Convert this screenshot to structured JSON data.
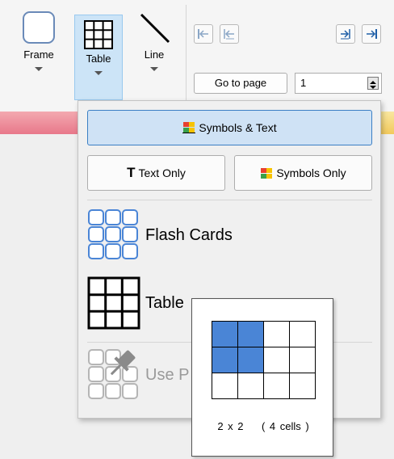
{
  "ribbon": {
    "frame_label": "Frame",
    "table_label": "Table",
    "line_label": "Line",
    "goto_label": "Go to page",
    "page_value": "1"
  },
  "dropdown": {
    "symbols_text": "Symbols & Text",
    "text_only": "Text Only",
    "symbols_only": "Symbols Only",
    "flash_cards": "Flash Cards",
    "table": "Table",
    "use_pin": "Use P"
  },
  "picker": {
    "rows": 3,
    "cols": 4,
    "selected_rows": 2,
    "selected_cols": 2,
    "size_text": "2 x 2",
    "cells_text": "( 4 cells )"
  },
  "colors": {
    "selection": "#4a85d6",
    "highlight": "#cfe2f5",
    "accent_border": "#3b7fc4"
  }
}
